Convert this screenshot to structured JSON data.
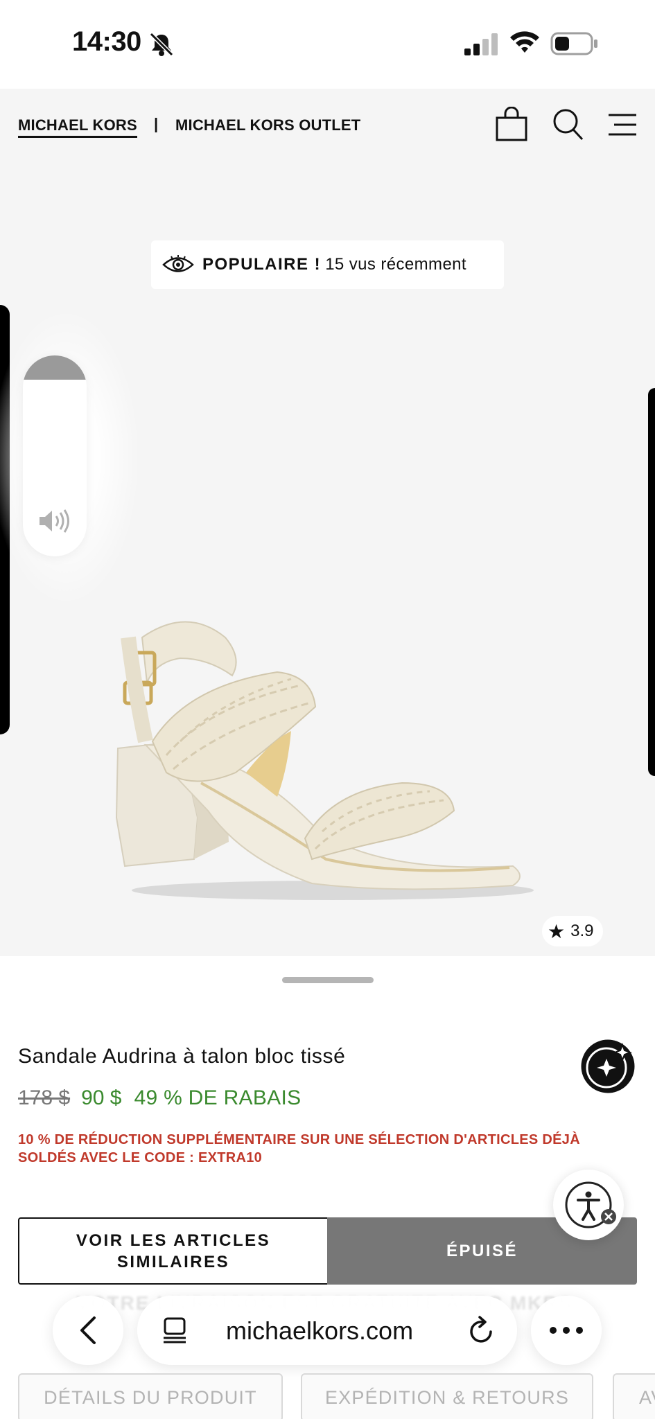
{
  "status_bar": {
    "time": "14:30",
    "icons": [
      "bell-slash-icon",
      "cellular-signal-icon",
      "wifi-icon",
      "battery-icon"
    ]
  },
  "header": {
    "brand_main": "MICHAEL KORS",
    "separator": "|",
    "brand_outlet": "MICHAEL KORS OUTLET",
    "icons": [
      "shopping-bag-icon",
      "search-icon",
      "menu-icon"
    ]
  },
  "product_media": {
    "popular_label": "POPULAIRE !",
    "popular_detail": "15 vus récemment",
    "rating": "3.9",
    "volume_level": 0.12
  },
  "product": {
    "title": "Sandale Audrina à talon bloc tissé",
    "original_price": "178 $",
    "sale_price": "90 $",
    "discount": "49 % DE RABAIS",
    "promo": "10 % DE RÉDUCTION SUPPLÉMENTAIRE SUR UNE SÉLECTION D'ARTICLES DÉJÀ SOLDÉS AVEC LE CODE : EXTRA10",
    "similar_button_line1": "VOIR LES ARTICLES",
    "similar_button_line2": "SIMILAIRES",
    "sold_out_button": "ÉPUISÉ",
    "obscured_banner": "VOTRE LIVRAISON EST GRATUITE AVEC MKRS"
  },
  "browser": {
    "url": "michaelkors.com"
  },
  "detail_tabs": [
    "DÉTAILS DU PRODUIT",
    "EXPÉDITION & RETOURS",
    "AV"
  ],
  "colors": {
    "sale_green": "#3a8a2e",
    "promo_red": "#c0392b",
    "sold_out_grey": "#777777"
  }
}
